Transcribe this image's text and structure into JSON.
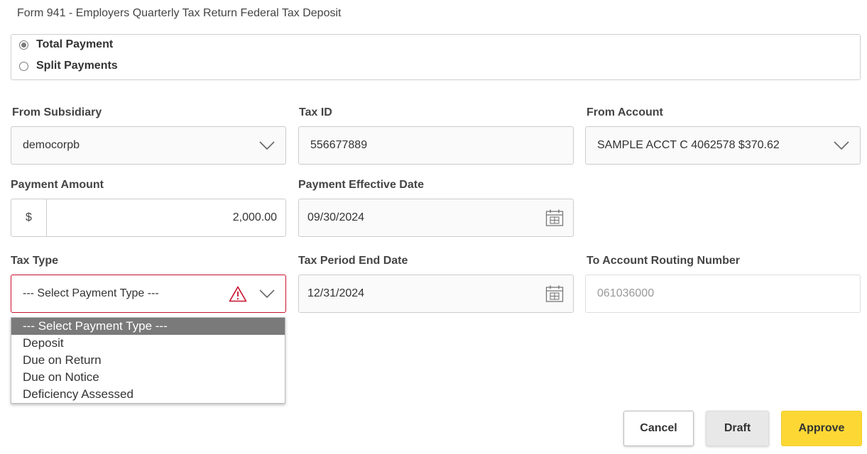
{
  "form_title": "Form 941 - Employers Quarterly Tax Return Federal Tax Deposit",
  "payment_options": [
    {
      "label": "Total Payment",
      "checked": true
    },
    {
      "label": "Split Payments",
      "checked": false
    }
  ],
  "from_subsidiary": {
    "label": "From Subsidiary",
    "value": "democorpb"
  },
  "tax_id": {
    "label": "Tax ID",
    "value": "556677889"
  },
  "from_account": {
    "label": "From Account",
    "value": "SAMPLE ACCT C 4062578 $370.62"
  },
  "payment_amount": {
    "label": "Payment Amount",
    "prefix": "$",
    "value": "2,000.00"
  },
  "payment_effective_date": {
    "label": "Payment Effective Date",
    "value": "09/30/2024"
  },
  "tax_type": {
    "label": "Tax Type",
    "value": "--- Select Payment Type ---",
    "options": [
      "--- Select Payment Type ---",
      "Deposit",
      "Due on Return",
      "Due on Notice",
      "Deficiency Assessed"
    ]
  },
  "tax_period_end_date": {
    "label": "Tax Period End Date",
    "value": "12/31/2024"
  },
  "to_account_routing": {
    "label": "To Account Routing Number",
    "value": "061036000"
  },
  "buttons": {
    "cancel": "Cancel",
    "draft": "Draft",
    "approve": "Approve"
  },
  "colors": {
    "error": "#c8102e",
    "approve": "#fdd835",
    "selected_option": "#7a7a7a"
  }
}
